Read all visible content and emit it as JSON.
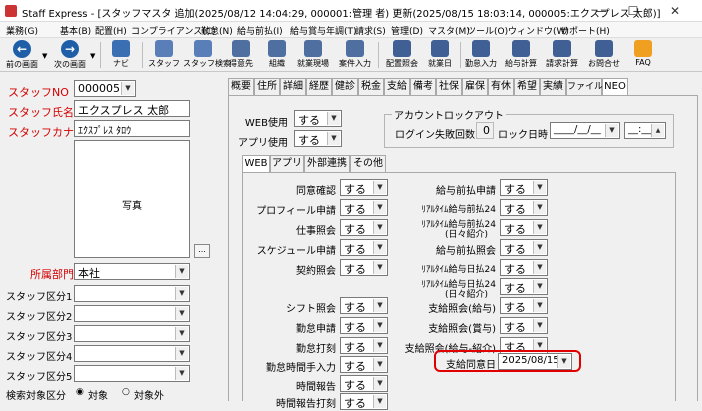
{
  "window": {
    "title": "Staff Express - [スタッフマスタ 追加(2025/08/12 14:04:29, 000001:管理 者) 更新(2025/08/15 18:03:14, 000005:エクスプレス 太郎)]",
    "minimize": "—",
    "maximize": "☐",
    "close": "✕"
  },
  "menu": [
    "業務(G)",
    "基本(B)",
    "配置(H)",
    "コンプライアンス(C)",
    "勤怠(N)",
    "給与前払(I)",
    "給与賞与年調(T)",
    "請求(S)",
    "管理(D)",
    "マスタ(M)",
    "ツール(O)",
    "ウィンドウ(W)",
    "サポート(H)"
  ],
  "toolbar": {
    "prev": "前の画面",
    "next": "次の画面",
    "items": [
      "ナビ",
      "スタッフ",
      "スタッフ検索",
      "得意先",
      "組織",
      "就業現場",
      "案件入力",
      "配置照会",
      "就業日",
      "勤怠入力",
      "給与計算",
      "請求計算",
      "お問合せ",
      "FAQ"
    ]
  },
  "left": {
    "staff_no_label": "スタッフNO",
    "staff_no": "000005",
    "name_label": "スタッフ氏名",
    "name": "エクスプレス 太郎",
    "kana_label": "スタッフカナ",
    "kana": "ｴｸｽﾌﾟﾚｽ ﾀﾛｳ",
    "photo_label": "写真",
    "photo_btn": "...",
    "dept_label": "所属部門",
    "dept": "本社",
    "kubun_labels": [
      "スタッフ区分1",
      "スタッフ区分2",
      "スタッフ区分3",
      "スタッフ区分4",
      "スタッフ区分5"
    ],
    "search_label": "検索対象区分",
    "radio1": "対象",
    "radio2": "対象外"
  },
  "main_tabs": [
    "概要",
    "住所",
    "詳細",
    "経歴",
    "健診",
    "税金",
    "支給",
    "備考",
    "社保",
    "雇保",
    "有休",
    "希望",
    "実績",
    "ファイル",
    "NEO"
  ],
  "neo": {
    "web_label": "WEB使用",
    "web_value": "する",
    "app_label": "アプリ使用",
    "app_value": "する",
    "lock_title": "アカウントロックアウト",
    "lock_fail_label": "ログイン失敗回数",
    "lock_fail_value": "0",
    "lock_date_label": "ロック日時",
    "lock_date_value": "____/__/__",
    "lock_time_value": "__:__"
  },
  "sub_tabs": [
    "WEB",
    "アプリ",
    "外部連携",
    "その他"
  ],
  "left_rows": [
    {
      "label": "同意確認",
      "value": "する"
    },
    {
      "label": "プロフィール申請",
      "value": "する"
    },
    {
      "label": "仕事照会",
      "value": "する"
    },
    {
      "label": "スケジュール申請",
      "value": "する"
    },
    {
      "label": "契約照会",
      "value": "する"
    },
    {
      "label": "シフト照会",
      "value": "する"
    },
    {
      "label": "勤怠申請",
      "value": "する"
    },
    {
      "label": "勤怠打刻",
      "value": "する"
    },
    {
      "label": "勤怠時間手入力",
      "value": "する"
    },
    {
      "label": "時間報告",
      "value": "する"
    },
    {
      "label": "時間報告打刻",
      "value": "する"
    }
  ],
  "right_rows": [
    {
      "label": "給与前払申請",
      "value": "する"
    },
    {
      "label": "ﾘｱﾙﾀｲﾑ給与前払24",
      "value": "する"
    },
    {
      "label": "ﾘｱﾙﾀｲﾑ給与前払24",
      "sub": "(日々紹介)",
      "value": "する"
    },
    {
      "label": "給与前払照会",
      "value": "する"
    },
    {
      "label": "ﾘｱﾙﾀｲﾑ給与日払24",
      "value": "する"
    },
    {
      "label": "ﾘｱﾙﾀｲﾑ給与日払24",
      "sub": "(日々紹介)",
      "value": "する"
    },
    {
      "label": "支給照会(給与)",
      "value": "する"
    },
    {
      "label": "支給照会(賞与)",
      "value": "する"
    },
    {
      "label": "支給照会(給与-紹介)",
      "value": "する"
    }
  ],
  "highlight": {
    "label": "支給同意日",
    "value": "2025/08/15",
    "color": "#e00000"
  }
}
